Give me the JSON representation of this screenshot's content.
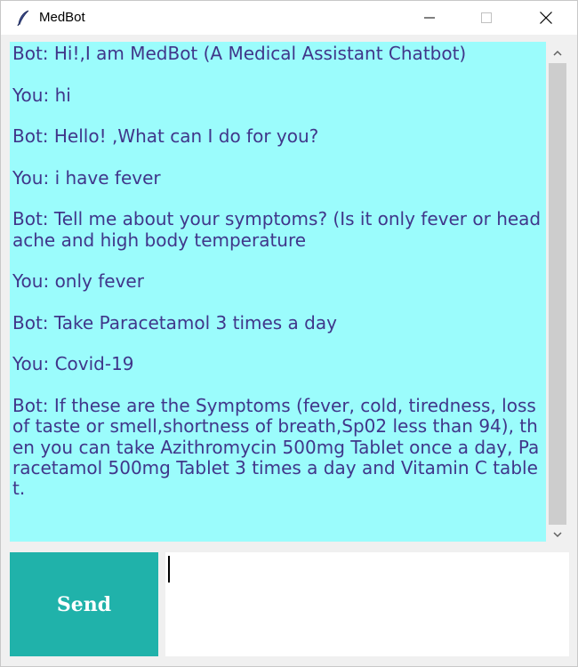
{
  "window": {
    "title": "MedBot",
    "icon": "feather-icon"
  },
  "chat": {
    "transcript": "Bot: Hi!,I am MedBot (A Medical Assistant Chatbot)\n\nYou: hi\n\nBot: Hello! ,What can I do for you?\n\nYou: i have fever\n\nBot: Tell me about your symptoms? (Is it only fever or headache and high body temperature\n\nYou: only fever\n\nBot: Take Paracetamol 3 times a day\n\nYou: Covid-19\n\nBot: If these are the Symptoms (fever, cold, tiredness, loss of taste or smell,shortness of breath,Sp02 less than 94), then you can take Azithromycin 500mg Tablet once a day, Paracetamol 500mg Tablet 3 times a day and Vitamin C tablet.",
    "background": "#9bfcfc",
    "text_color": "#40368a"
  },
  "input": {
    "send_label": "Send",
    "send_color": "#20b2aa",
    "value": ""
  }
}
